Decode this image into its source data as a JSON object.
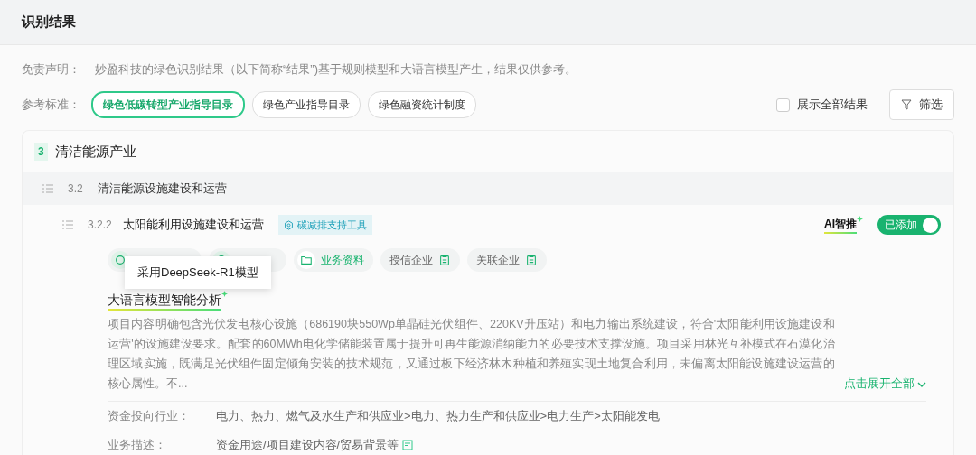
{
  "header": {
    "title": "识别结果"
  },
  "disclaimer": {
    "label": "免责声明：",
    "text": "妙盈科技的绿色识别结果（以下简称“结果”)基于规则模型和大语言模型产生，结果仅供参考。"
  },
  "standards": {
    "label": "参考标准：",
    "items": [
      {
        "label": "绿色低碳转型产业指导目录",
        "selected": true
      },
      {
        "label": "绿色产业指导目录",
        "selected": false
      },
      {
        "label": "绿色融资统计制度",
        "selected": false
      }
    ]
  },
  "show_all": {
    "label": "展示全部结果",
    "checked": false
  },
  "filter_button": {
    "label": "筛选"
  },
  "section": {
    "code": "3",
    "title": "清洁能源产业",
    "subsection": {
      "code": "3.2",
      "title": "清洁能源设施建设和运营",
      "item": {
        "code": "3.2.2",
        "title": "太阳能利用设施建设和运营",
        "tag": "碳减排支持工具",
        "ai_label": "AI智推",
        "switch": {
          "label": "已添加",
          "on": true
        },
        "pills": [
          {
            "kind": "covered"
          },
          {
            "kind": "covered"
          },
          {
            "kind": "folder",
            "label": "业务资料",
            "active": true
          },
          {
            "kind": "clip",
            "label": "授信企业",
            "active": false
          },
          {
            "kind": "clip",
            "label": "关联企业",
            "active": false
          }
        ],
        "tooltip": "采用DeepSeek-R1模型",
        "analysis": {
          "title": "大语言模型智能分析",
          "text": "项目内容明确包含光伏发电核心设施（686190块550Wp单晶硅光伏组件、220KV升压站）和电力输出系统建设，符合'太阳能利用设施建设和运营'的设施建设要求。配套的60MWh电化学储能装置属于提升可再生能源消纳能力的必要技术支撑设施。项目采用林光互补模式在石漠化治理区域实施，既满足光伏组件固定倾角安装的技术规范，又通过板下经济林木种植和养殖实现土地复合利用，未偏离太阳能设施建设运营的核心属性。不...",
          "expand": "点击展开全部"
        },
        "fields": [
          {
            "label": "资金投向行业：",
            "value": "电力、热力、燃气及水生产和供应业>电力、热力生产和供应业>电力生产>太阳能发电",
            "note": false
          },
          {
            "label": "业务描述：",
            "value": "资金用途/项目建设内容/贸易背景等",
            "note": true
          }
        ]
      }
    }
  }
}
